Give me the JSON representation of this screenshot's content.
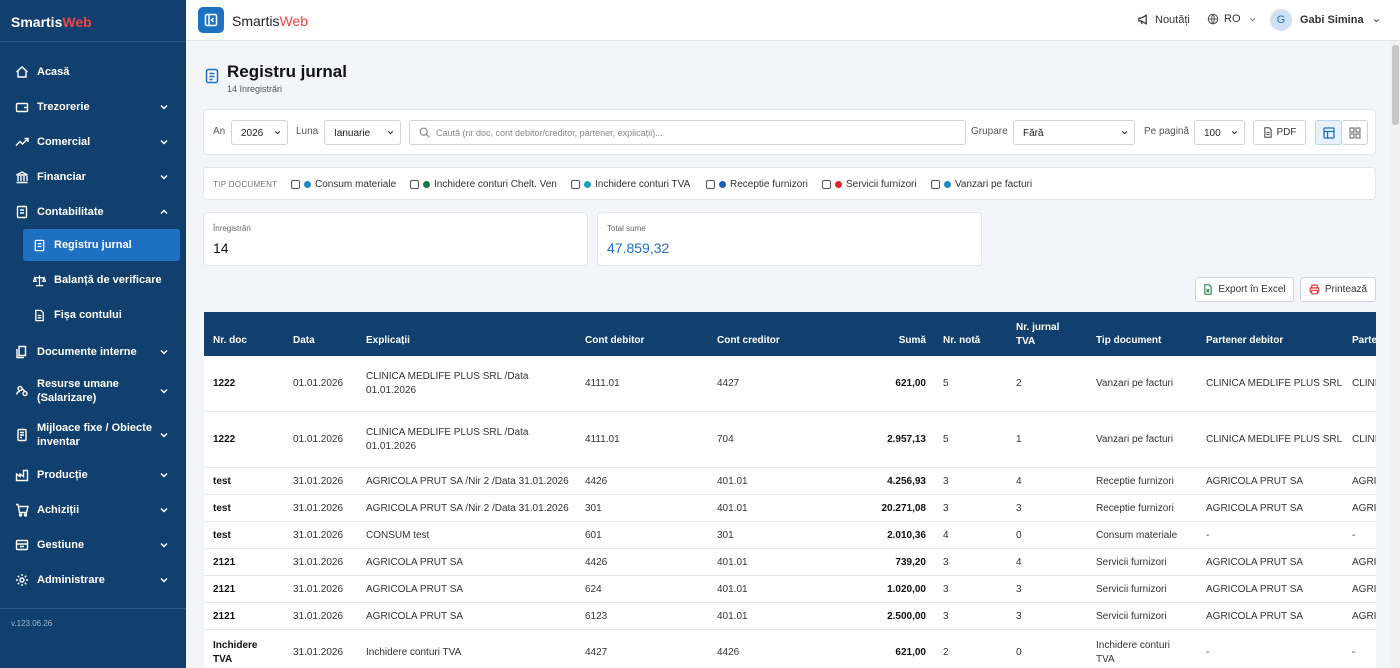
{
  "sidebar": {
    "brand_main": "Smartis",
    "brand_accent": "Web",
    "items": [
      {
        "label": "Acasă",
        "icon": "home-icon"
      },
      {
        "label": "Trezorerie",
        "icon": "wallet-icon"
      },
      {
        "label": "Comercial",
        "icon": "trending-up-icon"
      },
      {
        "label": "Financiar",
        "icon": "bank-icon"
      },
      {
        "label": "Contabilitate",
        "icon": "book-icon"
      },
      {
        "label": "Documente interne",
        "icon": "documents-icon"
      },
      {
        "label": "Resurse umane (Salarizare)",
        "icon": "people-icon"
      },
      {
        "label": "Mijloace fixe / Obiecte inventar",
        "icon": "assets-icon"
      },
      {
        "label": "Producție",
        "icon": "factory-icon"
      },
      {
        "label": "Achiziții",
        "icon": "cart-icon"
      },
      {
        "label": "Gestiune",
        "icon": "warehouse-icon"
      },
      {
        "label": "Administrare",
        "icon": "gear-icon"
      }
    ],
    "subitems": [
      {
        "label": "Registru jurnal",
        "icon": "journal-icon"
      },
      {
        "label": "Balanță de verificare",
        "icon": "scale-icon"
      },
      {
        "label": "Fișa contului",
        "icon": "file-icon"
      }
    ],
    "version": "v.123.06.26"
  },
  "topbar": {
    "app_main": "Smartis",
    "app_accent": "Web",
    "news": "Noutăți",
    "lang": "RO",
    "avatar_initial": "G",
    "user": "Gabi Simina"
  },
  "page": {
    "title": "Registru jurnal",
    "subtitle": "14 înregistrări"
  },
  "filters": {
    "year_label": "An",
    "year": "2026",
    "month_label": "Luna",
    "month": "Ianuarie",
    "search_placeholder": "Caută (nr doc, cont debitor/creditor, partener, explicații)...",
    "group_label": "Grupare",
    "group": "Fără",
    "per_page_label": "Pe pagină",
    "per_page": "100",
    "pdf": "PDF"
  },
  "tipdoc": {
    "label": "TIP DOCUMENT",
    "types": [
      {
        "label": "Consum materiale",
        "color": "#1e88c7"
      },
      {
        "label": "Inchidere conturi Chelt. Ven",
        "color": "#16794a"
      },
      {
        "label": "Inchidere conturi TVA",
        "color": "#17a2b8"
      },
      {
        "label": "Receptie furnizori",
        "color": "#1e5bb0"
      },
      {
        "label": "Servicii furnizori",
        "color": "#dc2626"
      },
      {
        "label": "Vanzari pe facturi",
        "color": "#1e88c7"
      }
    ]
  },
  "stats": {
    "records_label": "Înregistrări",
    "records": "14",
    "total_label": "Total sume",
    "total": "47.859,32"
  },
  "actions": {
    "export": "Export în Excel",
    "print": "Printează"
  },
  "table": {
    "headers": {
      "nr_doc": "Nr. doc",
      "data": "Data",
      "explicatii": "Explicații",
      "debitor": "Cont debitor",
      "creditor": "Cont creditor",
      "suma": "Sumă",
      "nr_nota": "Nr. notă",
      "nr_jurnal_1": "Nr. jurnal",
      "nr_jurnal_2": "TVA",
      "tip": "Tip document",
      "partener_debitor": "Partener debitor",
      "partener_creditor": "Partener creditor"
    },
    "rows": [
      {
        "nr_doc": "1222",
        "data": "01.01.2026",
        "explicatii_1": "CLINICA MEDLIFE PLUS SRL /Data",
        "explicatii_2": "01.01.2026",
        "debitor": "4111.01",
        "creditor": "4427",
        "suma": "621,00",
        "nr_nota": "5",
        "nr_jurnal": "2",
        "tip_1": "Vanzari pe facturi",
        "tip_2": "",
        "partener_debitor": "CLINICA MEDLIFE PLUS SRL",
        "partener_creditor": "CLINICA MEDLIFE PLUS SRL"
      },
      {
        "nr_doc": "1222",
        "data": "01.01.2026",
        "explicatii_1": "CLINICA MEDLIFE PLUS SRL /Data",
        "explicatii_2": "01.01.2026",
        "debitor": "4111.01",
        "creditor": "704",
        "suma": "2.957,13",
        "nr_nota": "5",
        "nr_jurnal": "1",
        "tip_1": "Vanzari pe facturi",
        "tip_2": "",
        "partener_debitor": "CLINICA MEDLIFE PLUS SRL",
        "partener_creditor": "CLINICA MEDLIFE PLUS SRL"
      },
      {
        "nr_doc": "test",
        "data": "31.01.2026",
        "explicatii_1": "AGRICOLA PRUT SA /Nir 2 /Data 31.01.2026",
        "explicatii_2": "",
        "debitor": "4426",
        "creditor": "401.01",
        "suma": "4.256,93",
        "nr_nota": "3",
        "nr_jurnal": "4",
        "tip_1": "Receptie furnizori",
        "tip_2": "",
        "partener_debitor": "AGRICOLA PRUT SA",
        "partener_creditor": "AGRICOLA PRUT SA"
      },
      {
        "nr_doc": "test",
        "data": "31.01.2026",
        "explicatii_1": "AGRICOLA PRUT SA /Nir 2 /Data 31.01.2026",
        "explicatii_2": "",
        "debitor": "301",
        "creditor": "401.01",
        "suma": "20.271,08",
        "nr_nota": "3",
        "nr_jurnal": "3",
        "tip_1": "Receptie furnizori",
        "tip_2": "",
        "partener_debitor": "AGRICOLA PRUT SA",
        "partener_creditor": "AGRICOLA PRUT SA"
      },
      {
        "nr_doc": "test",
        "data": "31.01.2026",
        "explicatii_1": "CONSUM test",
        "explicatii_2": "",
        "debitor": "601",
        "creditor": "301",
        "suma": "2.010,36",
        "nr_nota": "4",
        "nr_jurnal": "0",
        "tip_1": "Consum materiale",
        "tip_2": "",
        "partener_debitor": "-",
        "partener_creditor": "-"
      },
      {
        "nr_doc": "2121",
        "data": "31.01.2026",
        "explicatii_1": "AGRICOLA PRUT SA",
        "explicatii_2": "",
        "debitor": "4426",
        "creditor": "401.01",
        "suma": "739,20",
        "nr_nota": "3",
        "nr_jurnal": "4",
        "tip_1": "Servicii furnizori",
        "tip_2": "",
        "partener_debitor": "AGRICOLA PRUT SA",
        "partener_creditor": "AGRICOLA PRUT SA"
      },
      {
        "nr_doc": "2121",
        "data": "31.01.2026",
        "explicatii_1": "AGRICOLA PRUT SA",
        "explicatii_2": "",
        "debitor": "624",
        "creditor": "401.01",
        "suma": "1.020,00",
        "nr_nota": "3",
        "nr_jurnal": "3",
        "tip_1": "Servicii furnizori",
        "tip_2": "",
        "partener_debitor": "AGRICOLA PRUT SA",
        "partener_creditor": "AGRICOLA PRUT SA"
      },
      {
        "nr_doc": "2121",
        "data": "31.01.2026",
        "explicatii_1": "AGRICOLA PRUT SA",
        "explicatii_2": "",
        "debitor": "6123",
        "creditor": "401.01",
        "suma": "2.500,00",
        "nr_nota": "3",
        "nr_jurnal": "3",
        "tip_1": "Servicii furnizori",
        "tip_2": "",
        "partener_debitor": "AGRICOLA PRUT SA",
        "partener_creditor": "AGRICOLA PRUT SA"
      },
      {
        "nr_doc": "Inchidere TVA",
        "data": "31.01.2026",
        "explicatii_1": "Inchidere conturi TVA",
        "explicatii_2": "",
        "debitor": "4427",
        "creditor": "4426",
        "suma": "621,00",
        "nr_nota": "2",
        "nr_jurnal": "0",
        "tip_1": "Inchidere conturi",
        "tip_2": "TVA",
        "partener_debitor": "-",
        "partener_creditor": "-"
      }
    ]
  }
}
